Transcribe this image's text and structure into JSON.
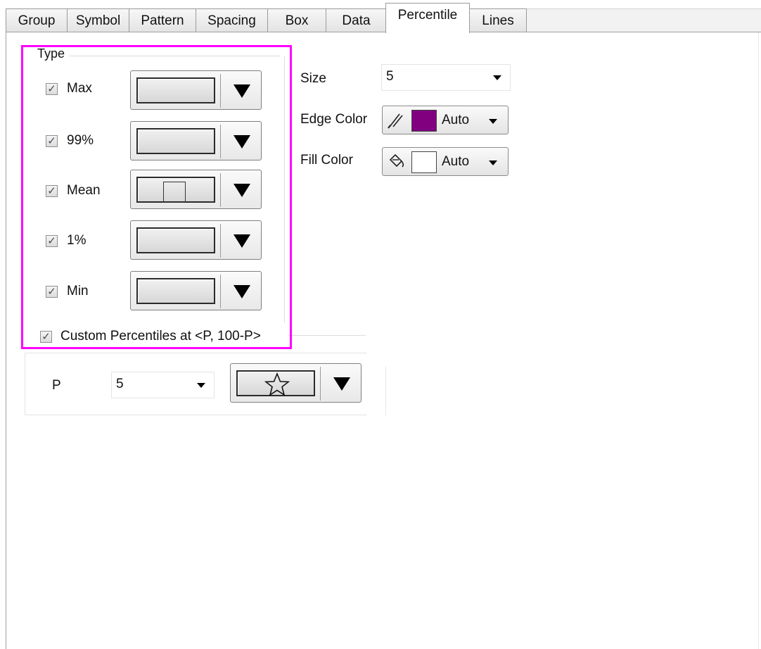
{
  "tabs": [
    {
      "label": "Group"
    },
    {
      "label": "Symbol"
    },
    {
      "label": "Pattern"
    },
    {
      "label": "Spacing"
    },
    {
      "label": "Box"
    },
    {
      "label": "Data"
    },
    {
      "label": "Percentile",
      "active": true
    },
    {
      "label": "Lines"
    }
  ],
  "type_group": {
    "title": "Type",
    "items": [
      {
        "label": "Max",
        "checked": true,
        "symbol": "blank"
      },
      {
        "label": "99%",
        "checked": true,
        "symbol": "blank"
      },
      {
        "label": "Mean",
        "checked": true,
        "symbol": "square"
      },
      {
        "label": "1%",
        "checked": true,
        "symbol": "blank"
      },
      {
        "label": "Min",
        "checked": true,
        "symbol": "blank"
      }
    ],
    "custom_percentiles": {
      "label": "Custom Percentiles at <P, 100-P>",
      "checked": true
    }
  },
  "p_group": {
    "label": "P",
    "value": "5",
    "symbol": "star"
  },
  "right_panel": {
    "size_label": "Size",
    "size_value": "5",
    "edge_color_label": "Edge Color",
    "edge_color_value": "Auto",
    "edge_color_swatch": "#800080",
    "fill_color_label": "Fill Color",
    "fill_color_value": "Auto",
    "fill_color_swatch": "#ffffff"
  },
  "icons": {
    "checkmark": "✓",
    "star": "☆"
  }
}
